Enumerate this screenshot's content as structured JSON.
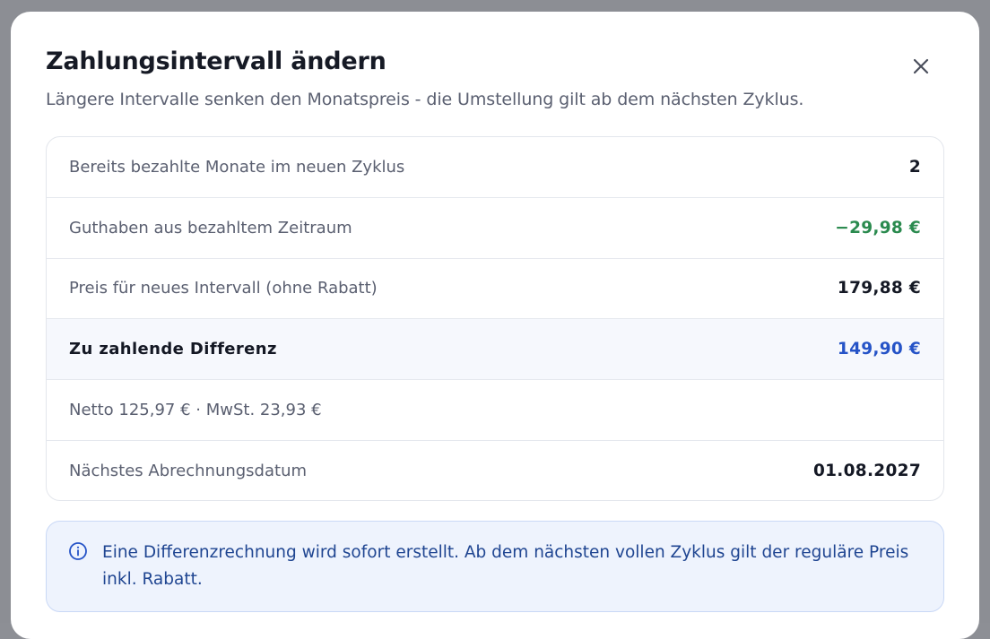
{
  "modal": {
    "title": "Zahlungsintervall ändern",
    "subtitle": "Längere Intervalle senken den Monatspreis - die Umstellung gilt ab dem nächsten Zyklus.",
    "close_icon": "close-icon"
  },
  "summary": {
    "rows": [
      {
        "label": "Bereits bezahlte Monate im neuen Zyklus",
        "value": "2"
      },
      {
        "label": "Guthaben aus bezahltem Zeitraum",
        "value": "−29,98 €"
      },
      {
        "label": "Preis für neues Intervall (ohne Rabatt)",
        "value": "179,88 €"
      },
      {
        "label": "Zu zahlende Differenz",
        "value": "149,90 €"
      },
      {
        "label": "Netto 125,97 € · MwSt. 23,93 €",
        "value": ""
      },
      {
        "label": "Nächstes Abrechnungsdatum",
        "value": "01.08.2027"
      }
    ]
  },
  "info": {
    "icon": "info-icon",
    "text": "Eine Differenzrechnung wird sofort erstellt. Ab dem nächsten vollen Zyklus gilt der reguläre Preis inkl. Rabatt."
  },
  "colors": {
    "credit_green": "#2a8a4e",
    "accent_blue": "#2553c7",
    "info_background": "#eef3fd",
    "info_text": "#1f4591"
  }
}
